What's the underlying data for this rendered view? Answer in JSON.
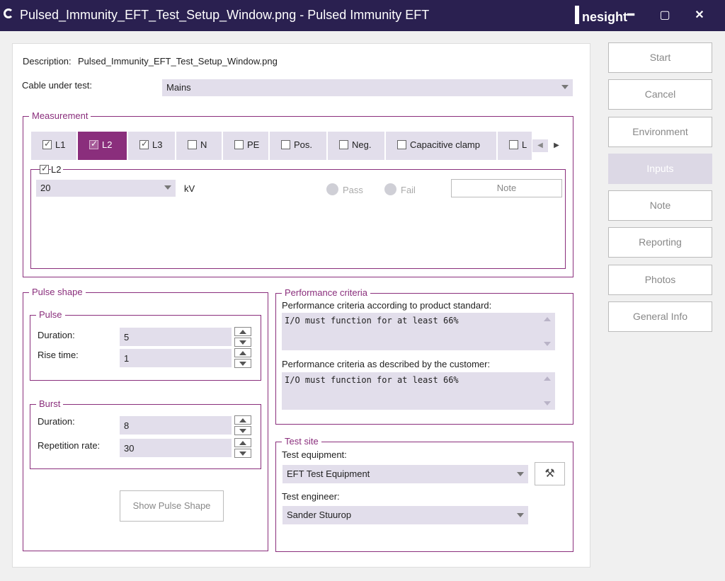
{
  "window": {
    "title": "Pulsed_Immunity_EFT_Test_Setup_Window.png - Pulsed Immunity EFT",
    "brand": "nesight",
    "minimize_glyph": "━",
    "maximize_glyph": "▢",
    "close_glyph": "✕"
  },
  "description": {
    "label": "Description:",
    "value": "Pulsed_Immunity_EFT_Test_Setup_Window.png"
  },
  "cable": {
    "label": "Cable under test:",
    "value": "Mains"
  },
  "measurement": {
    "title": "Measurement",
    "tabs": [
      {
        "label": "L1",
        "checked": true
      },
      {
        "label": "L2",
        "checked": true
      },
      {
        "label": "L3",
        "checked": true
      },
      {
        "label": "N",
        "checked": false
      },
      {
        "label": "PE",
        "checked": false
      },
      {
        "label": "Pos.",
        "checked": false
      },
      {
        "label": "Neg.",
        "checked": false
      },
      {
        "label": "Capacitive clamp",
        "checked": false
      },
      {
        "label": "L",
        "checked": false
      }
    ],
    "active_tab": "L2",
    "sub_label": "L2",
    "voltage": "20",
    "unit": "kV",
    "pass_label": "Pass",
    "fail_label": "Fail",
    "note_label": "Note"
  },
  "pulse_shape": {
    "title": "Pulse shape",
    "pulse": {
      "title": "Pulse",
      "duration_label": "Duration:",
      "duration": "5",
      "rise_label": "Rise time:",
      "rise": "1"
    },
    "burst": {
      "title": "Burst",
      "duration_label": "Duration:",
      "duration": "8",
      "rep_label": "Repetition rate:",
      "rep": "30"
    },
    "show_button": "Show Pulse Shape"
  },
  "performance": {
    "title": "Performance criteria",
    "standard_label": "Performance criteria according to product standard:",
    "standard_value": "I/O must function for at least 66%",
    "customer_label": "Performance criteria as described by the customer:",
    "customer_value": "I/O must function for at least 66%"
  },
  "test_site": {
    "title": "Test site",
    "equipment_label": "Test equipment:",
    "equipment_value": "EFT Test Equipment",
    "engineer_label": "Test engineer:",
    "engineer_value": "Sander Stuurop"
  },
  "sidebar": {
    "buttons": [
      "Start",
      "Cancel",
      "Environment",
      "Inputs",
      "Note",
      "Reporting",
      "Photos",
      "General Info"
    ],
    "active": "Inputs"
  },
  "colors": {
    "accent": "#8a2e7c",
    "titlebar": "#2a2050",
    "field": "#e2deeb"
  }
}
